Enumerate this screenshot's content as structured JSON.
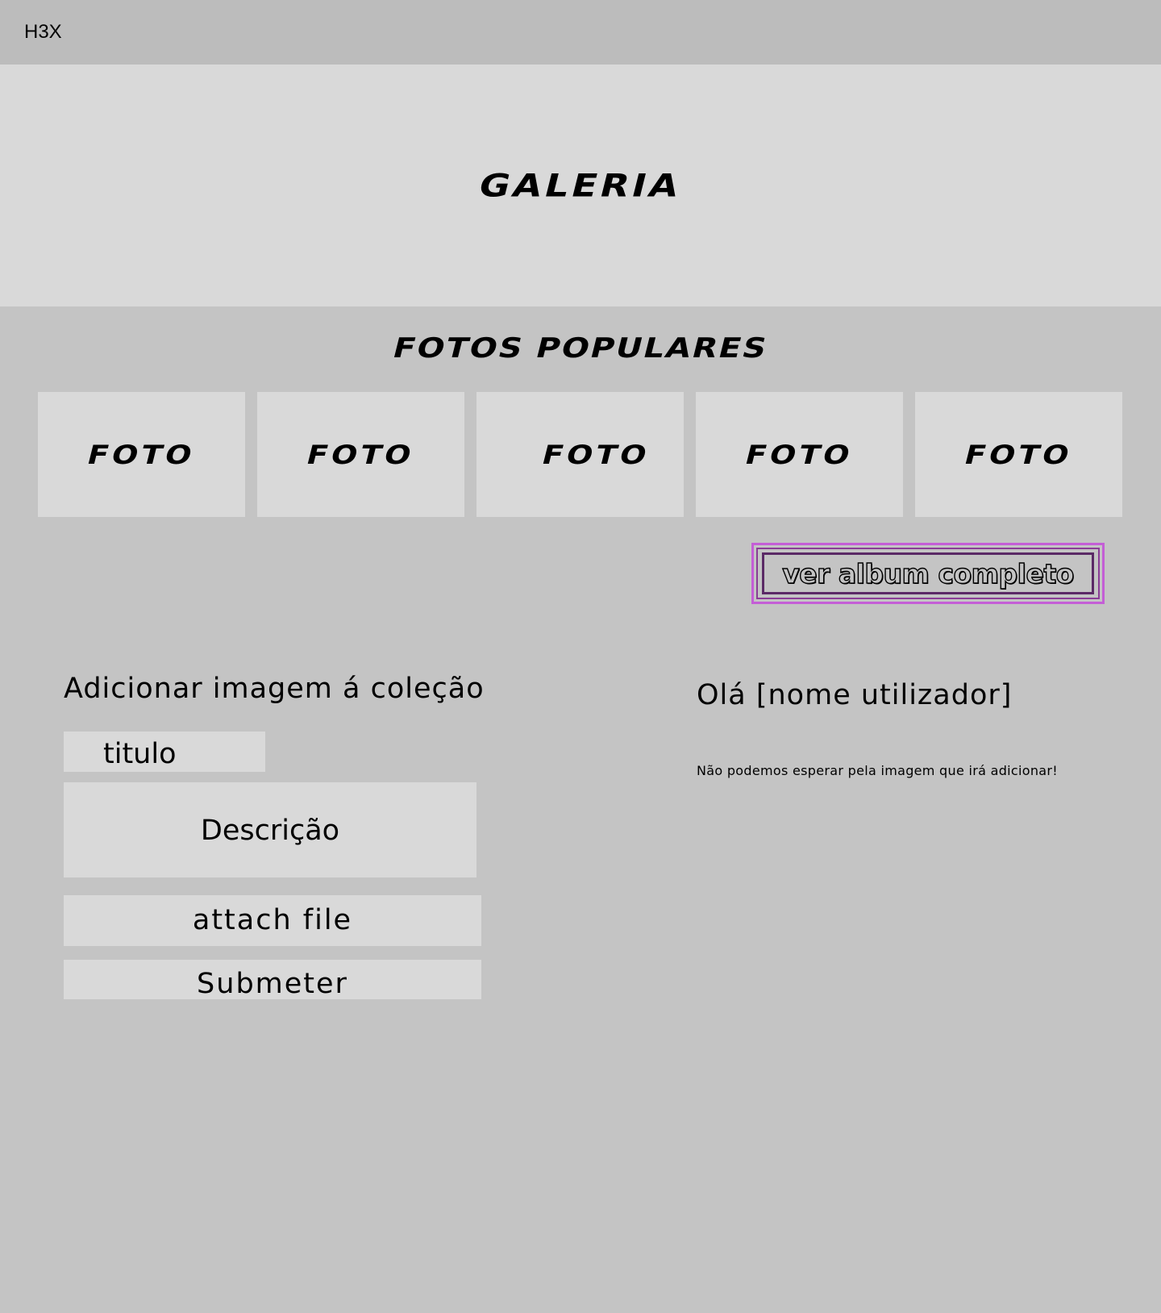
{
  "header": {
    "brand": "H3X"
  },
  "hero": {
    "title": "GALERIA"
  },
  "popular": {
    "title": "FOTOS POPULARES",
    "photos": [
      {
        "label": "FOTO"
      },
      {
        "label": "FOTO"
      },
      {
        "label": "FOTO"
      },
      {
        "label": "FOTO"
      },
      {
        "label": "FOTO"
      }
    ],
    "album_button_label": "ver album completo"
  },
  "form": {
    "heading": "Adicionar imagem á coleção",
    "title_placeholder": "titulo",
    "description_placeholder": "Descrição",
    "attach_label": "attach file",
    "submit_label": "Submeter"
  },
  "greeting": {
    "title": "Olá [nome utilizador]",
    "message": "Não podemos esperar pela imagem que irá adicionar!"
  },
  "colors": {
    "page_background": "#c4c4c4",
    "header_background": "#bcbcbc",
    "panel_background": "#d9d9d9",
    "accent_outline": "#c45ed6",
    "accent_inner": "#5b2a66"
  }
}
